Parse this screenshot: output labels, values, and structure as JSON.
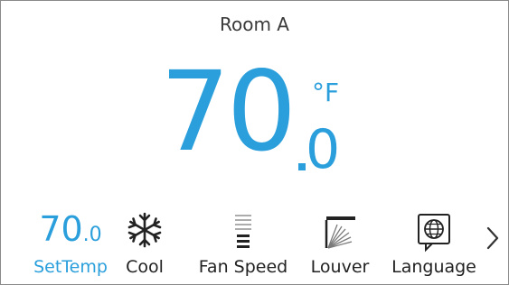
{
  "room": {
    "name": "Room A"
  },
  "temperature": {
    "whole": "70",
    "decimal": "0",
    "unit": "°F"
  },
  "controls": {
    "settemp": {
      "whole": "70",
      "decimal": ".0",
      "label": "SetTemp"
    },
    "mode": {
      "label": "Cool",
      "icon": "snowflake-icon"
    },
    "fan": {
      "label": "Fan Speed",
      "icon": "fan-speed-icon"
    },
    "louver": {
      "label": "Louver",
      "icon": "louver-icon"
    },
    "language": {
      "label": "Language",
      "icon": "globe-icon"
    },
    "next": {
      "icon": "chevron-right-icon"
    }
  },
  "colors": {
    "accent": "#2b9fdc",
    "text": "#222222",
    "border": "#8a8a8a"
  }
}
